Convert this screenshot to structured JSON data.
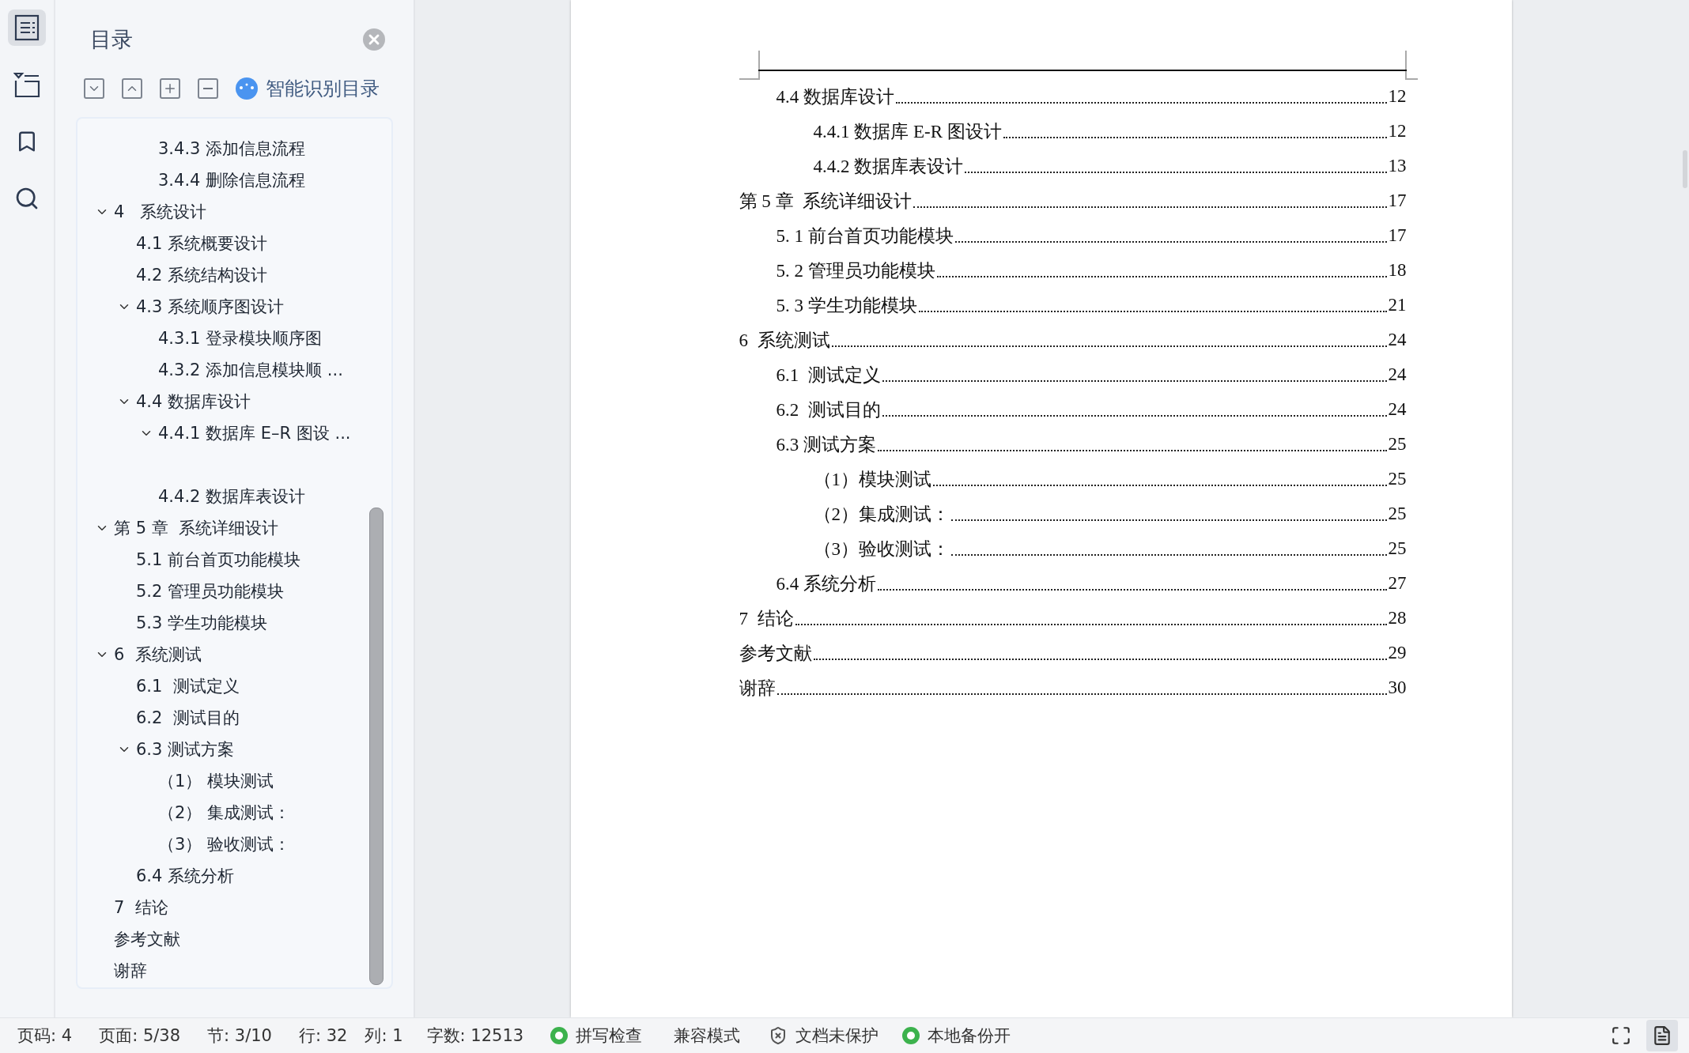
{
  "rail": [
    {
      "kind": "toc",
      "selected": true
    },
    {
      "kind": "outline",
      "selected": false
    },
    {
      "kind": "bookmark",
      "selected": false
    },
    {
      "kind": "search",
      "selected": false
    }
  ],
  "sidebar": {
    "title": "目录",
    "smart_button": "智能识别目录",
    "tree": {
      "partial_branch": [
        {
          "label": "3.4.3 添加信息流程"
        },
        {
          "label": "3.4.4 删除信息流程"
        }
      ],
      "items": [
        {
          "label": "4   系统设计",
          "expanded": true,
          "children": [
            {
              "label": "4.1 系统概要设计"
            },
            {
              "label": "4.2 系统结构设计"
            },
            {
              "label": "4.3 系统顺序图设计",
              "expanded": true,
              "children": [
                {
                  "label": "4.3.1 登录模块顺序图"
                },
                {
                  "label": "4.3.2 添加信息模块顺 ..."
                }
              ]
            },
            {
              "label": "4.4 数据库设计",
              "expanded": true,
              "children": [
                {
                  "label": "4.4.1 数据库 E–R 图设 ...",
                  "expanded": true
                },
                {
                  "label": "4.4.2 数据库表设计"
                }
              ]
            }
          ]
        },
        {
          "label": "第 5 章  系统详细设计",
          "expanded": true,
          "children": [
            {
              "label": "5.1 前台首页功能模块"
            },
            {
              "label": "5.2 管理员功能模块"
            },
            {
              "label": "5.3 学生功能模块"
            }
          ]
        },
        {
          "label": "6  系统测试",
          "expanded": true,
          "children": [
            {
              "label": "6.1  测试定义"
            },
            {
              "label": "6.2  测试目的"
            },
            {
              "label": "6.3 测试方案",
              "expanded": true,
              "children": [
                {
                  "label": "（1） 模块测试"
                },
                {
                  "label": "（2） 集成测试："
                },
                {
                  "label": "（3） 验收测试："
                }
              ]
            },
            {
              "label": "6.4 系统分析"
            }
          ]
        },
        {
          "label": "7  结论"
        },
        {
          "label": "参考文献"
        },
        {
          "label": "谢辞"
        }
      ]
    }
  },
  "document": {
    "partial_branch": [
      {
        "text": "4.4 数据库设计",
        "page": "12",
        "children": [
          {
            "text": "4.4.1 数据库 E-R 图设计",
            "page": "12"
          },
          {
            "text": "4.4.2 数据库表设计",
            "page": "13"
          }
        ]
      }
    ],
    "entries": [
      {
        "text": "第 5 章  系统详细设计",
        "page": "17",
        "children": [
          {
            "text": "5. 1 前台首页功能模块",
            "page": "17"
          },
          {
            "text": "5. 2 管理员功能模块",
            "page": "18"
          },
          {
            "text": "5. 3 学生功能模块",
            "page": "21"
          }
        ]
      },
      {
        "text": "6  系统测试",
        "page": "24",
        "children": [
          {
            "text": "6.1  测试定义",
            "page": "24"
          },
          {
            "text": "6.2  测试目的",
            "page": "24"
          },
          {
            "text": "6.3 测试方案",
            "page": "25",
            "children": [
              {
                "text": "（1）模块测试",
                "page": "25"
              },
              {
                "text": "（2）集成测试：",
                "page": "25"
              },
              {
                "text": "（3）验收测试：",
                "page": "25"
              }
            ]
          },
          {
            "text": "6.4 系统分析",
            "page": "27"
          }
        ]
      },
      {
        "text": "7  结论",
        "page": "28"
      },
      {
        "text": "参考文献",
        "page": "29"
      },
      {
        "text": "谢辞",
        "page": "30"
      }
    ]
  },
  "status_bar": {
    "items": [
      {
        "kind": "text",
        "label": "页码: 4"
      },
      {
        "kind": "text",
        "label": "页面: 5/38"
      },
      {
        "kind": "text",
        "label": "节: 3/10"
      },
      {
        "kind": "text",
        "label": "行: 32"
      },
      {
        "kind": "text",
        "label": "列: 1"
      },
      {
        "kind": "text",
        "label": "字数: 12513"
      },
      {
        "kind": "ok",
        "label": "拼写检查"
      },
      {
        "kind": "text",
        "label": "兼容模式"
      },
      {
        "kind": "shield",
        "label": "文档未保护"
      },
      {
        "kind": "ok",
        "label": "本地备份开"
      }
    ],
    "view_buttons": [
      {
        "kind": "fullscreen",
        "selected": false
      },
      {
        "kind": "page",
        "selected": true
      }
    ]
  }
}
